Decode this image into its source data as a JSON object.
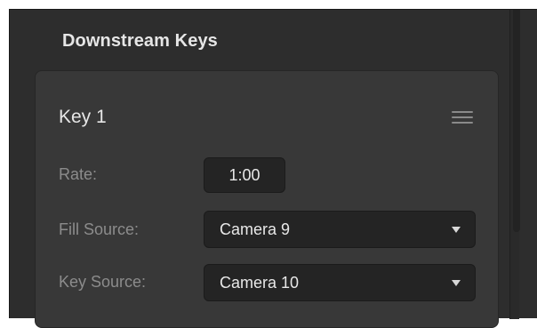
{
  "panel": {
    "title": "Downstream Keys"
  },
  "key1": {
    "title": "Key 1",
    "menu_icon": "hamburger-menu-icon",
    "rate": {
      "label": "Rate:",
      "value": "1:00"
    },
    "fill_source": {
      "label": "Fill Source:",
      "value": "Camera 9"
    },
    "key_source": {
      "label": "Key Source:",
      "value": "Camera 10"
    }
  },
  "colors": {
    "background": "#2d2d2d",
    "card": "#383838",
    "field": "#242424",
    "text_primary": "#e6e6e6",
    "text_secondary": "#8c8c8c"
  }
}
